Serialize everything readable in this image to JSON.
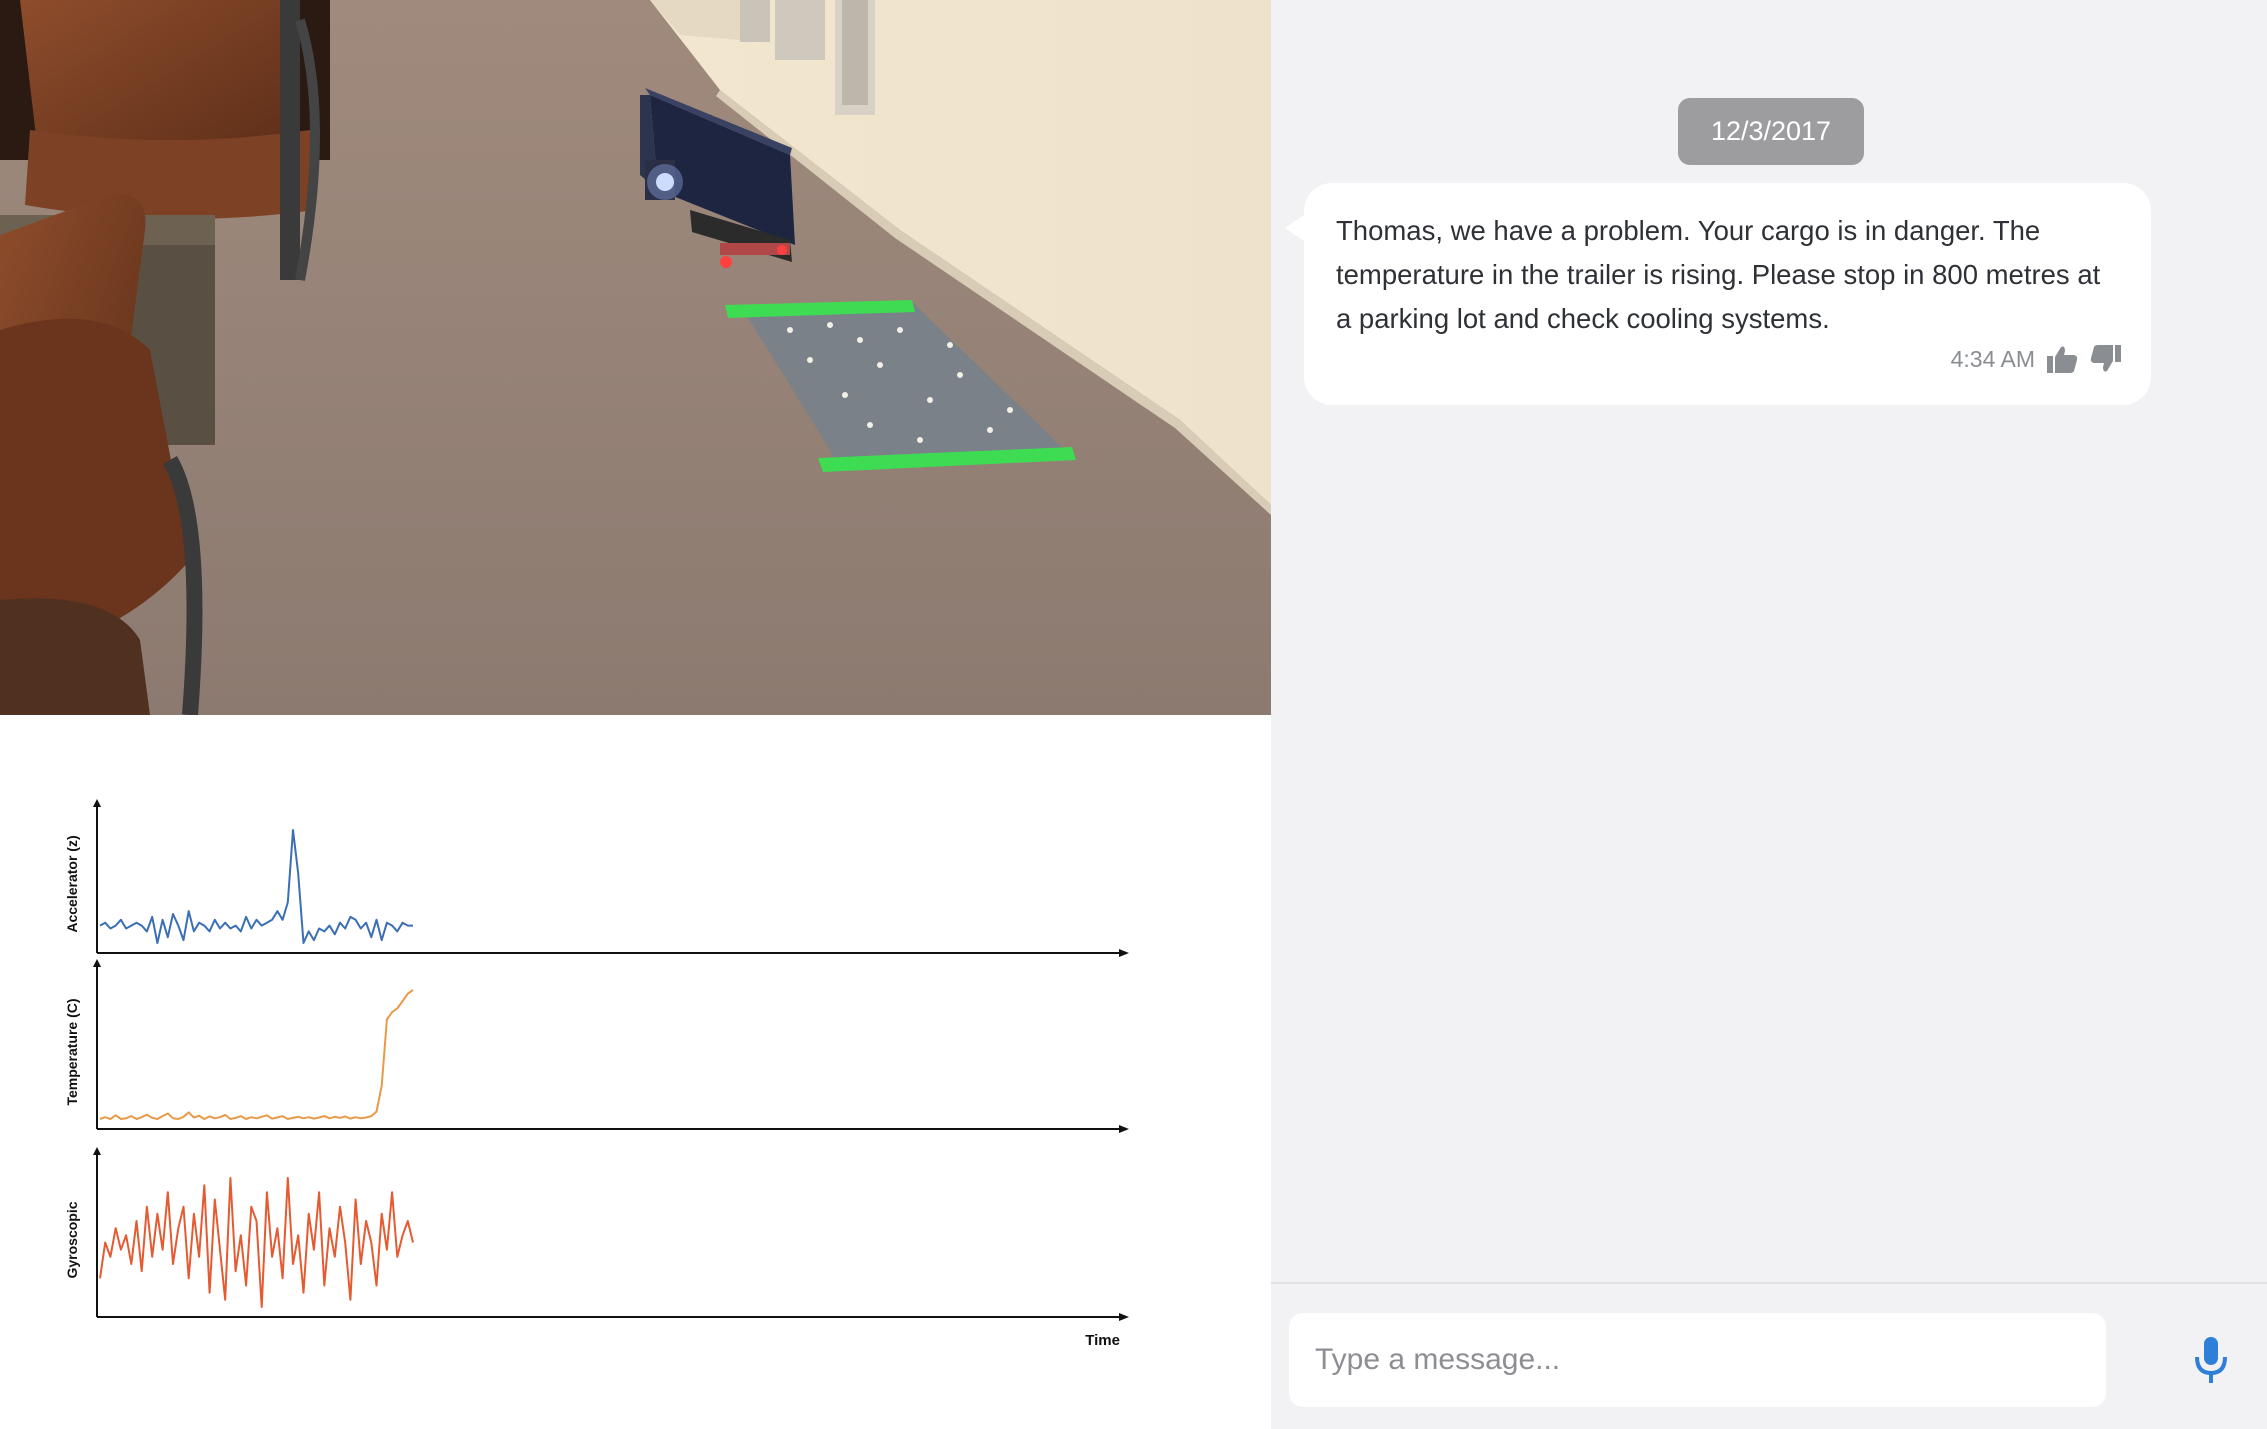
{
  "chat": {
    "date_badge": "12/3/2017",
    "messages": [
      {
        "text": "Thomas, we have a problem. Your cargo is in danger. The temperature in the trailer is rising. Please stop in 800 metres at a parking lot and check cooling systems.",
        "time": "4:34 AM"
      }
    ],
    "input_placeholder": "Type a message...",
    "icons": {
      "like": "thumbs-up-icon",
      "dislike": "thumbs-down-icon",
      "mic": "microphone-icon"
    },
    "colors": {
      "background": "#f2f2f4",
      "badge": "#9d9d9f",
      "mic": "#2d7fd8"
    }
  },
  "chart_data": [
    {
      "type": "line",
      "ylabel": "Accelerator (z)",
      "xlabel": "",
      "color": "#3b6fb4",
      "x": [
        0,
        1,
        2,
        3,
        4,
        5,
        6,
        7,
        8,
        9,
        10,
        11,
        12,
        13,
        14,
        15,
        16,
        17,
        18,
        19,
        20,
        21,
        22,
        23,
        24,
        25,
        26,
        27,
        28,
        29,
        30,
        31,
        32,
        33,
        34,
        35,
        36,
        37,
        38,
        39,
        40,
        41,
        42,
        43,
        44,
        45,
        46,
        47,
        48,
        49,
        50,
        51,
        52,
        53,
        54,
        55,
        56,
        57,
        58,
        59,
        60
      ],
      "values": [
        0,
        1,
        -1,
        0,
        2,
        -1,
        0,
        1,
        0,
        -2,
        3,
        -6,
        2,
        -4,
        4,
        0,
        -5,
        5,
        -2,
        1,
        0,
        -2,
        2,
        -1,
        1,
        -1,
        0,
        -2,
        3,
        -1,
        2,
        0,
        1,
        2,
        5,
        2,
        8,
        33,
        18,
        -6,
        -2,
        -5,
        -1,
        -2,
        0,
        -3,
        1,
        -1,
        3,
        2,
        -1,
        1,
        -4,
        2,
        -5,
        1,
        0,
        -2,
        1,
        0,
        0
      ]
    },
    {
      "type": "line",
      "ylabel": "Temperature (C)",
      "xlabel": "",
      "color": "#e89a4a",
      "x": [
        0,
        1,
        2,
        3,
        4,
        5,
        6,
        7,
        8,
        9,
        10,
        11,
        12,
        13,
        14,
        15,
        16,
        17,
        18,
        19,
        20,
        21,
        22,
        23,
        24,
        25,
        26,
        27,
        28,
        29,
        30,
        31,
        32,
        33,
        34,
        35,
        36,
        37,
        38,
        39,
        40,
        41,
        42,
        43,
        44,
        45,
        46,
        47,
        48,
        49,
        50,
        51,
        52,
        53,
        54,
        55,
        56,
        57,
        58,
        59,
        60
      ],
      "values": [
        1,
        1.5,
        1,
        2,
        1,
        1.2,
        1.8,
        1,
        1.5,
        2.2,
        1.3,
        1,
        1.8,
        2.5,
        1.2,
        1,
        1.6,
        2.8,
        1.4,
        1.9,
        1,
        1.7,
        1.2,
        1.5,
        2.1,
        1,
        1.3,
        1.8,
        1,
        1.5,
        1.2,
        1.6,
        2,
        1.1,
        1.4,
        1.8,
        1,
        1.3,
        1.6,
        1.2,
        1.5,
        1.1,
        1.4,
        1.8,
        1.2,
        1.6,
        1.3,
        1.7,
        1.1,
        1.5,
        1.2,
        1.4,
        1.8,
        3,
        10,
        28,
        30,
        31,
        33,
        35,
        36
      ]
    },
    {
      "type": "line",
      "ylabel": "Gyroscopic",
      "xlabel": "Time",
      "color": "#e65a32",
      "x": [
        0,
        1,
        2,
        3,
        4,
        5,
        6,
        7,
        8,
        9,
        10,
        11,
        12,
        13,
        14,
        15,
        16,
        17,
        18,
        19,
        20,
        21,
        22,
        23,
        24,
        25,
        26,
        27,
        28,
        29,
        30,
        31,
        32,
        33,
        34,
        35,
        36,
        37,
        38,
        39,
        40,
        41,
        42,
        43,
        44,
        45,
        46,
        47,
        48,
        49,
        50,
        51,
        52,
        53,
        54,
        55,
        56,
        57,
        58,
        59,
        60
      ],
      "values": [
        0,
        5,
        3,
        7,
        4,
        6,
        2,
        8,
        1,
        10,
        3,
        9,
        4,
        12,
        2,
        7,
        10,
        0,
        9,
        3,
        13,
        -2,
        11,
        4,
        -3,
        14,
        1,
        6,
        -1,
        10,
        8,
        -4,
        12,
        3,
        7,
        0,
        14,
        2,
        6,
        -2,
        9,
        4,
        12,
        -1,
        7,
        3,
        10,
        5,
        -3,
        11,
        2,
        8,
        5,
        -1,
        9,
        4,
        12,
        3,
        6,
        8,
        5
      ]
    }
  ]
}
